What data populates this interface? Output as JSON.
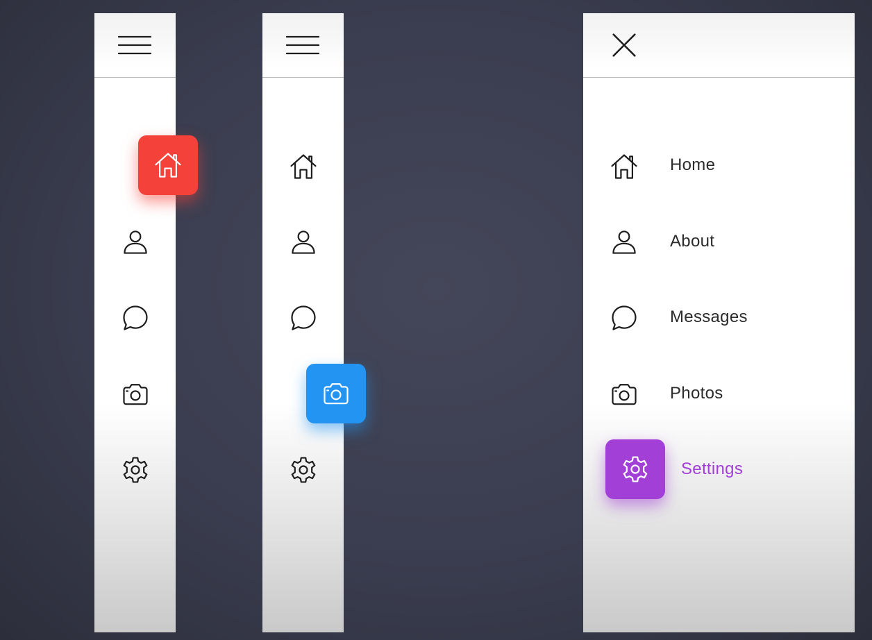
{
  "colors": {
    "background": "#3a3d4f",
    "panel": "#ffffff",
    "home_active": "#f4413a",
    "photos_active": "#2394f2",
    "settings_active": "#a23fd6",
    "settings_label": "#a23fd6"
  },
  "panel_collapsed_home": {
    "toggle_icon": "hamburger-icon",
    "active_item": "home",
    "items": [
      {
        "id": "home",
        "icon": "home-icon"
      },
      {
        "id": "about",
        "icon": "user-icon"
      },
      {
        "id": "messages",
        "icon": "chat-bubble-icon"
      },
      {
        "id": "photos",
        "icon": "camera-icon"
      },
      {
        "id": "settings",
        "icon": "gear-icon"
      }
    ]
  },
  "panel_collapsed_photos": {
    "toggle_icon": "hamburger-icon",
    "active_item": "photos",
    "items": [
      {
        "id": "home",
        "icon": "home-icon"
      },
      {
        "id": "about",
        "icon": "user-icon"
      },
      {
        "id": "messages",
        "icon": "chat-bubble-icon"
      },
      {
        "id": "photos",
        "icon": "camera-icon"
      },
      {
        "id": "settings",
        "icon": "gear-icon"
      }
    ]
  },
  "panel_expanded": {
    "toggle_icon": "close-icon",
    "active_item": "settings",
    "items": [
      {
        "id": "home",
        "icon": "home-icon",
        "label": "Home"
      },
      {
        "id": "about",
        "icon": "user-icon",
        "label": "About"
      },
      {
        "id": "messages",
        "icon": "chat-bubble-icon",
        "label": "Messages"
      },
      {
        "id": "photos",
        "icon": "camera-icon",
        "label": "Photos"
      },
      {
        "id": "settings",
        "icon": "gear-icon",
        "label": "Settings"
      }
    ]
  }
}
